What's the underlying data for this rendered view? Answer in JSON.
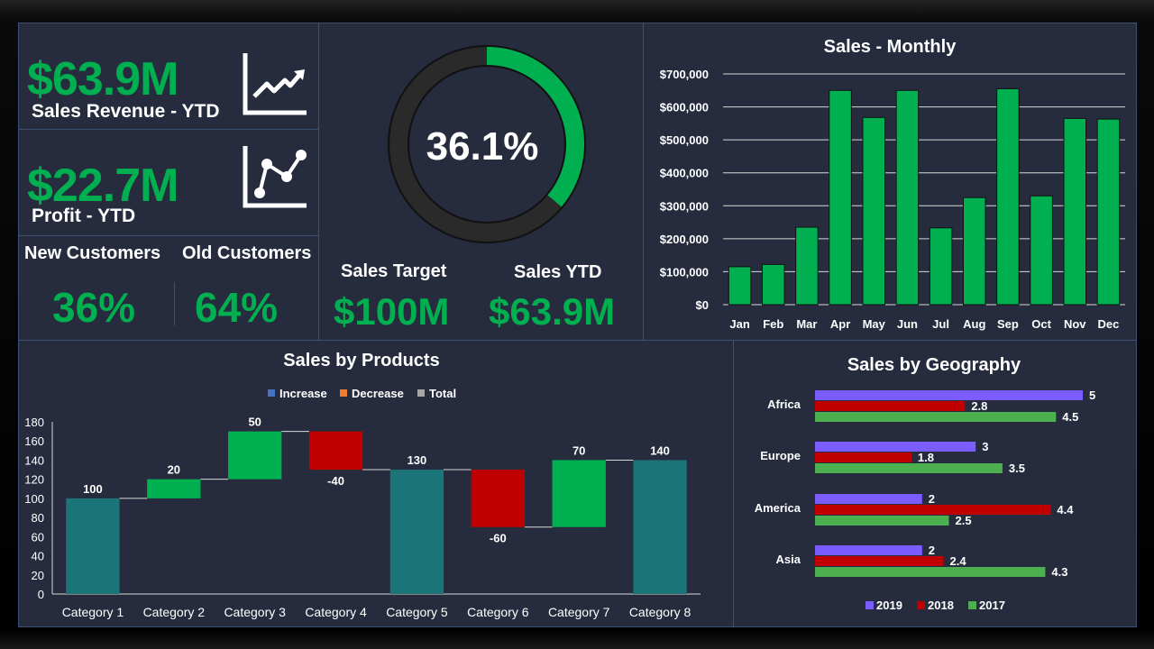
{
  "kpis": {
    "revenue": {
      "value": "$63.9M",
      "label": "Sales Revenue - YTD",
      "icon": "trend-up-chart-icon"
    },
    "profit": {
      "value": "$22.7M",
      "label": "Profit - YTD",
      "icon": "line-graph-icon"
    },
    "new_customers": {
      "label": "New Customers",
      "value": "36%"
    },
    "old_customers": {
      "label": "Old Customers",
      "value": "64%"
    }
  },
  "gauge": {
    "percent_text": "36.1%",
    "fraction": 0.361,
    "target_label": "Sales Target",
    "target_value": "$100M",
    "ytd_label": "Sales YTD",
    "ytd_value": "$63.9M"
  },
  "colors": {
    "green": "#00b050",
    "red": "#c00000",
    "teal": "#1a7478",
    "purple": "#7b5cff",
    "geo_red": "#c00000",
    "geo_green": "#4caf50",
    "legend_increase": "#4472c4",
    "legend_decrease": "#ed7d31",
    "legend_total": "#a5a5a5"
  },
  "chart_data": [
    {
      "type": "bar",
      "title": "Sales - Monthly",
      "categories": [
        "Jan",
        "Feb",
        "Mar",
        "Apr",
        "May",
        "Jun",
        "Jul",
        "Aug",
        "Sep",
        "Oct",
        "Nov",
        "Dec"
      ],
      "values": [
        115000,
        122000,
        235000,
        650000,
        568000,
        650000,
        233000,
        325000,
        655000,
        330000,
        565000,
        563000
      ],
      "ylim": [
        0,
        700000
      ],
      "yticks": [
        "$0",
        "$100,000",
        "$200,000",
        "$300,000",
        "$400,000",
        "$500,000",
        "$600,000",
        "$700,000"
      ],
      "grid": true
    },
    {
      "type": "bar",
      "subtype": "waterfall",
      "title": "Sales by Products",
      "legend": [
        "Increase",
        "Decrease",
        "Total"
      ],
      "categories": [
        "Category 1",
        "Category 2",
        "Category 3",
        "Category 4",
        "Category 5",
        "Category 6",
        "Category 7",
        "Category 8"
      ],
      "values": [
        100,
        20,
        50,
        -40,
        130,
        -60,
        70,
        140
      ],
      "labels": [
        "100",
        "20",
        "50",
        "-40",
        "130",
        "-60",
        "70",
        "140"
      ],
      "kinds": [
        "total",
        "increase",
        "increase",
        "decrease",
        "total",
        "decrease",
        "increase",
        "total"
      ],
      "ylim": [
        0,
        180
      ],
      "yticks": [
        "0",
        "20",
        "40",
        "60",
        "80",
        "100",
        "120",
        "140",
        "160",
        "180"
      ]
    },
    {
      "type": "bar",
      "orientation": "horizontal",
      "title": "Sales by Geography",
      "categories": [
        "Africa",
        "Europe",
        "America",
        "Asia"
      ],
      "series": [
        {
          "name": "2019",
          "values": [
            5,
            3,
            2,
            2
          ]
        },
        {
          "name": "2018",
          "values": [
            2.8,
            1.8,
            4.4,
            2.4
          ]
        },
        {
          "name": "2017",
          "values": [
            4.5,
            3.5,
            2.5,
            4.3
          ]
        }
      ],
      "value_labels": [
        [
          "5",
          "3",
          "2",
          "2"
        ],
        [
          "2.8",
          "1.8",
          "4.4",
          "2.4"
        ],
        [
          "4.5",
          "3.5",
          "2.5",
          "4.3"
        ]
      ],
      "xlim": [
        0,
        5
      ]
    }
  ]
}
